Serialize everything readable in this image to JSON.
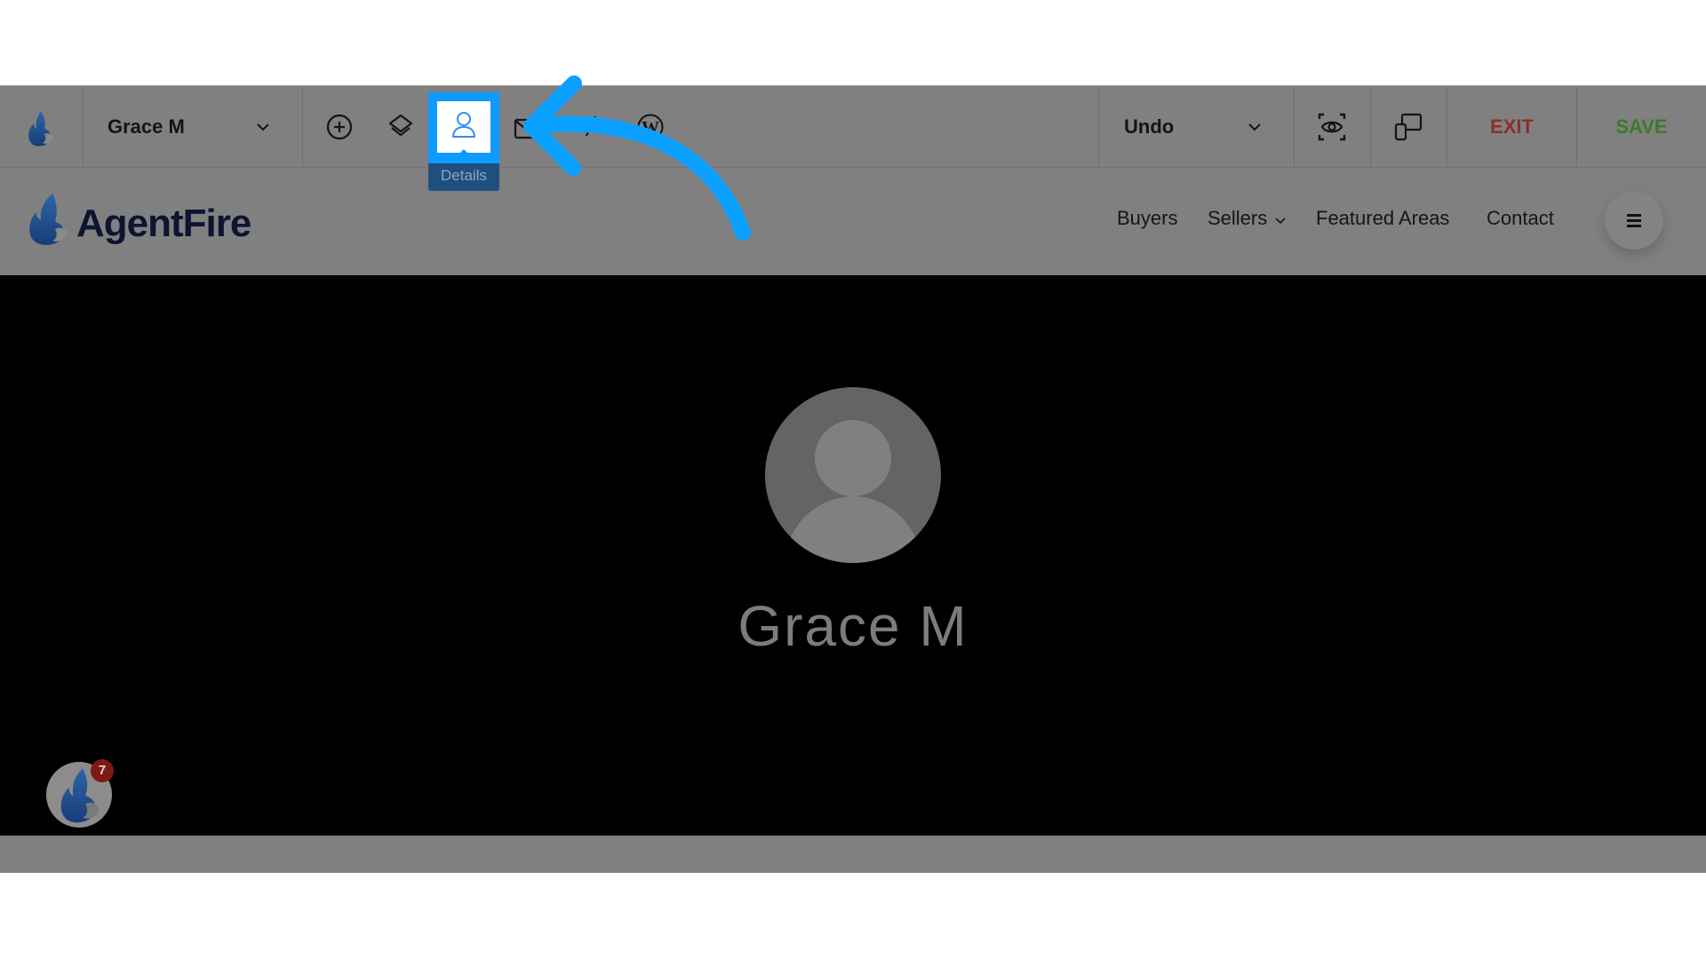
{
  "toolbar": {
    "site_selector": "Grace M",
    "tools": [
      {
        "name": "add",
        "icon": "plus-circle-icon"
      },
      {
        "name": "layers",
        "icon": "layers-icon"
      },
      {
        "name": "details",
        "icon": "user-icon",
        "tooltip": "Details",
        "active": true
      },
      {
        "name": "email",
        "icon": "envelope-icon"
      },
      {
        "name": "edit",
        "icon": "pen-icon"
      },
      {
        "name": "wordpress",
        "icon": "wordpress-icon"
      }
    ],
    "undo_label": "Undo",
    "preview_icon": "eye-icon",
    "responsive_icon": "devices-icon",
    "exit_label": "EXIT",
    "save_label": "SAVE",
    "colors": {
      "exit": "#8b2f2a",
      "save": "#3b7a2b",
      "active": "#0d9bff",
      "tooltip_bg": "#1f4f7f"
    }
  },
  "nav": {
    "logo_text": "AgentFire",
    "links": [
      {
        "label": "Buyers"
      },
      {
        "label": "Sellers",
        "has_dropdown": true
      },
      {
        "label": "Featured Areas"
      },
      {
        "label": "Contact"
      }
    ],
    "menu_icon": "hamburger-icon"
  },
  "hero": {
    "name": "Grace M",
    "avatar": "default-user-avatar"
  },
  "chat_widget": {
    "badge_count": "7"
  },
  "annotation": {
    "type": "arrow",
    "color": "#0ba0ff",
    "points_to": "details"
  }
}
